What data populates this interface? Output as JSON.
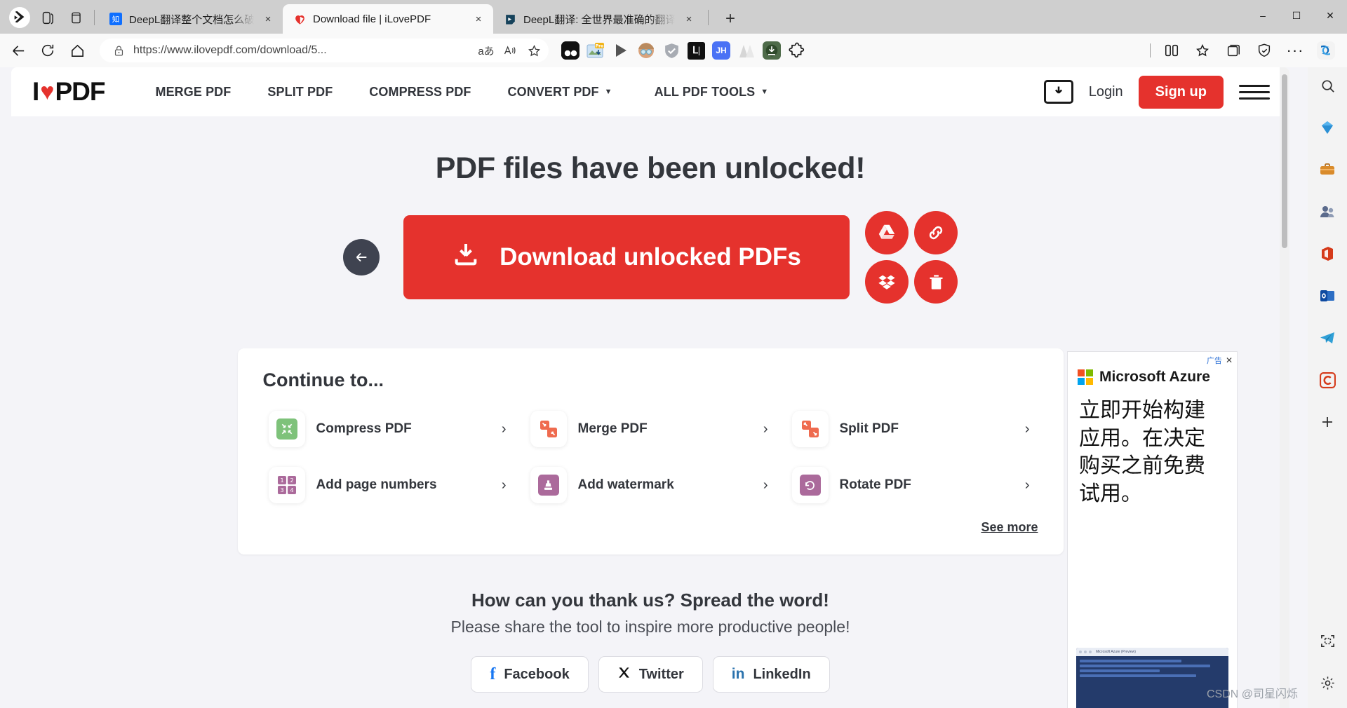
{
  "browser": {
    "tabs": [
      {
        "title": "DeepL翻译整个文档怎么破解只设",
        "favicon": "zhihu-icon",
        "active": false,
        "close_label": "×"
      },
      {
        "title": "Download file | iLovePDF",
        "favicon": "ilovepdf-heart-icon",
        "active": true,
        "close_label": "×"
      },
      {
        "title": "DeepL翻译: 全世界最准确的翻译",
        "favicon": "deepl-icon",
        "active": false,
        "close_label": "×"
      }
    ],
    "new_tab_label": "+",
    "window_controls": {
      "minimize": "–",
      "maximize": "☐",
      "close": "✕"
    },
    "url": "https://www.ilovepdf.com/download/5...",
    "omnibox_read_aloud": "A",
    "omnibox_translate": "aあ",
    "more_label": "···",
    "extensions": [
      {
        "name": "dark-reader-extension",
        "label": ""
      },
      {
        "name": "image-downloader-pro-extension",
        "label": "Pro"
      },
      {
        "name": "video-player-extension",
        "label": ""
      },
      {
        "name": "avatar-extension",
        "label": ""
      },
      {
        "name": "adguard-shield-extension",
        "label": ""
      },
      {
        "name": "li-extension",
        "label": "L"
      },
      {
        "name": "jh-extension",
        "label": "JH"
      },
      {
        "name": "aa-extension",
        "label": ""
      },
      {
        "name": "download-manager-extension",
        "label": ""
      },
      {
        "name": "puzzle-extensions-button",
        "label": ""
      }
    ]
  },
  "site": {
    "logo": {
      "i": "I",
      "heart": "♥",
      "pdf": "PDF"
    },
    "nav": [
      {
        "label": "MERGE PDF",
        "has_caret": false
      },
      {
        "label": "SPLIT PDF",
        "has_caret": false
      },
      {
        "label": "COMPRESS PDF",
        "has_caret": false
      },
      {
        "label": "CONVERT PDF",
        "has_caret": true
      },
      {
        "label": "ALL PDF TOOLS",
        "has_caret": true
      }
    ],
    "login_label": "Login",
    "signup_label": "Sign up",
    "accent_color": "#e5322d"
  },
  "hero": {
    "title": "PDF files have been unlocked!",
    "download_label": "Download unlocked PDFs",
    "back_label": "←",
    "actions": [
      {
        "name": "save-to-google-drive-button",
        "icon": "google-drive-icon"
      },
      {
        "name": "copy-link-button",
        "icon": "link-icon"
      },
      {
        "name": "save-to-dropbox-button",
        "icon": "dropbox-icon"
      },
      {
        "name": "delete-files-button",
        "icon": "trash-icon"
      }
    ]
  },
  "continue_card": {
    "title": "Continue to...",
    "see_more": "See more",
    "chevron": "›",
    "tools": [
      {
        "label": "Compress PDF",
        "icon": "compress-icon",
        "color": "#7ec27a"
      },
      {
        "label": "Merge PDF",
        "icon": "merge-icon",
        "color": "#ef6b4f"
      },
      {
        "label": "Split PDF",
        "icon": "split-icon",
        "color": "#ef6b4f"
      },
      {
        "label": "Add page numbers",
        "icon": "page-numbers-icon",
        "color": "#ab6a9b"
      },
      {
        "label": "Add watermark",
        "icon": "watermark-stamp-icon",
        "color": "#ab6a9b"
      },
      {
        "label": "Rotate PDF",
        "icon": "rotate-icon",
        "color": "#ab6a9b"
      }
    ]
  },
  "thanks": {
    "heading": "How can you thank us? Spread the word!",
    "subheading": "Please share the tool to inspire more productive people!",
    "socials": [
      {
        "label": "Facebook",
        "icon": "facebook-icon",
        "color": "#1877f2"
      },
      {
        "label": "Twitter",
        "icon": "twitter-x-icon",
        "color": "#111111"
      },
      {
        "label": "LinkedIn",
        "icon": "linkedin-icon",
        "color": "#2a72ad"
      }
    ]
  },
  "ad": {
    "label": "广告",
    "close": "✕",
    "brand": "Microsoft Azure",
    "copy": "立即开始构建应用。在决定购买之前免费试用。",
    "thumb_caption": "Microsoft Azure (Preview)"
  },
  "edge_sidebar": [
    {
      "name": "search-icon"
    },
    {
      "name": "shopping-diamond-icon"
    },
    {
      "name": "tools-briefcase-icon"
    },
    {
      "name": "games-icon"
    },
    {
      "name": "office-icon"
    },
    {
      "name": "outlook-icon"
    },
    {
      "name": "telegram-icon"
    },
    {
      "name": "copilot-c-icon"
    },
    {
      "name": "add-sidebar-app-icon"
    },
    {
      "name": "screenshot-capture-icon"
    },
    {
      "name": "sidebar-settings-icon"
    }
  ],
  "watermark": "CSDN @司星闪烁"
}
